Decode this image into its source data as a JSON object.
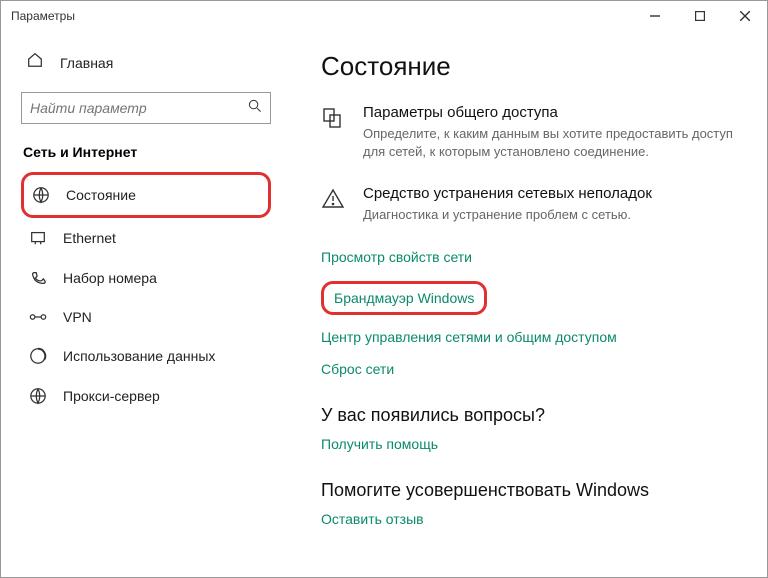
{
  "window": {
    "title": "Параметры"
  },
  "sidebar": {
    "home": "Главная",
    "searchPlaceholder": "Найти параметр",
    "category": "Сеть и Интернет",
    "items": [
      {
        "label": "Состояние"
      },
      {
        "label": "Ethernet"
      },
      {
        "label": "Набор номера"
      },
      {
        "label": "VPN"
      },
      {
        "label": "Использование данных"
      },
      {
        "label": "Прокси-сервер"
      }
    ]
  },
  "main": {
    "title": "Состояние",
    "sharing": {
      "heading": "Параметры общего доступа",
      "desc": "Определите, к каким данным вы хотите предоставить доступ для сетей, к которым установлено соединение."
    },
    "troubleshoot": {
      "heading": "Средство устранения сетевых неполадок",
      "desc": "Диагностика и устранение проблем с сетью."
    },
    "links": {
      "props": "Просмотр свойств сети",
      "firewall": "Брандмауэр Windows",
      "center": "Центр управления сетями и общим доступом",
      "reset": "Сброс сети"
    },
    "question": {
      "heading": "У вас появились вопросы?",
      "link": "Получить помощь"
    },
    "feedback": {
      "heading": "Помогите усовершенствовать Windows",
      "link": "Оставить отзыв"
    }
  }
}
